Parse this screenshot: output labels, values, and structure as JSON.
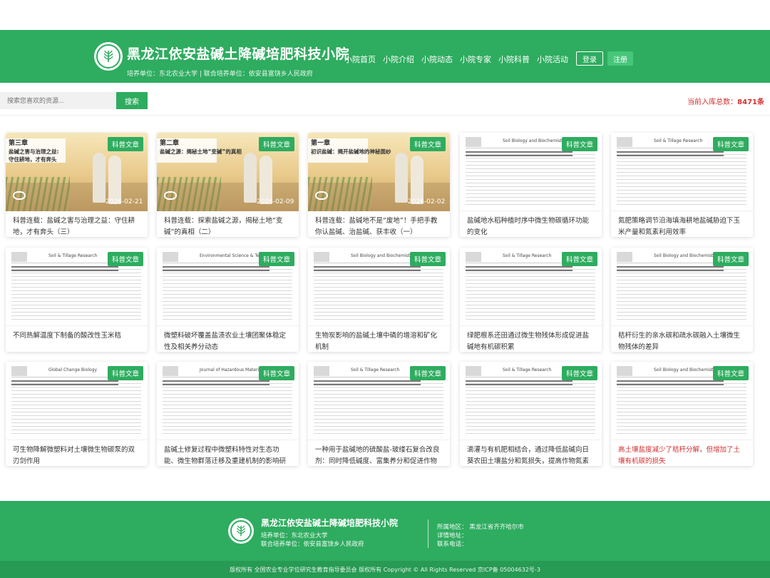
{
  "header": {
    "title": "黑龙江依安盐碱土降碱培肥科技小院",
    "subtitle": "培养单位：东北农业大学 |  联合培养单位：依安县富饶乡人民政府",
    "nav": [
      "小院首页",
      "小院介绍",
      "小院动态",
      "小院专家",
      "小院科普",
      "小院活动"
    ],
    "login": "登录",
    "register": "注册"
  },
  "search": {
    "placeholder": "搜索您喜欢的资源...",
    "button": "搜索",
    "total_label": "当前入库总数：",
    "total_value": "8471条"
  },
  "tag_label": "科普文章",
  "cards": [
    {
      "kind": "photo",
      "title": "科普连载：盐碱之害与治理之益：守住耕地，才有奔头（三）",
      "date": "2026-02-21",
      "ribbon_a": "第三章",
      "ribbon_b": "盐碱之害与治理之益:",
      "ribbon_c": "守住耕地，才有奔头"
    },
    {
      "kind": "photo",
      "title": "科普连载：探索盐碱之源，揭秘土地“变碱”的真相（二）",
      "date": "2026-02-09",
      "ribbon_a": "第二章",
      "ribbon_b": "盐碱之源：揭秘土地“变碱”的真相",
      "ribbon_c": ""
    },
    {
      "kind": "photo",
      "title": "科普连载：盐碱地不是“废地”！手把手教你认盐碱、治盐碱、获丰收（一）",
      "date": "2026-02-02",
      "ribbon_a": "第一章",
      "ribbon_b": "初识盐碱：揭开盐碱地的神秘面纱",
      "ribbon_c": ""
    },
    {
      "kind": "doc",
      "journal": "Soil Biology and Biochemistry",
      "title": "盐碱地水稻种植时序中微生物碳循环功能的变化"
    },
    {
      "kind": "doc",
      "journal": "Soil & Tillage Research",
      "title": "氮肥策略调节沿海填海耕地盐碱胁迫下玉米产量和氮素利用效率"
    },
    {
      "kind": "doc",
      "journal": "Soil & Tillage Research",
      "title": "不同热解温度下制备的酸改性玉米秸"
    },
    {
      "kind": "doc",
      "journal": "Environmental Science & Technology",
      "title": "微塑料破坏覆盖盐渍农业土壤团聚体稳定性及相关养分动态"
    },
    {
      "kind": "doc",
      "journal": "Soil Biology and Biochemistry",
      "title": "生物炭影响的盐碱土壤中磷的增溶和矿化机制"
    },
    {
      "kind": "doc",
      "journal": "Soil & Tillage Research",
      "title": "绿肥根系还田通过微生物残体形成促进盐碱地有机碳积累"
    },
    {
      "kind": "doc",
      "journal": "Soil Biology and Biochemistry",
      "title": "秸秆衍生的亲水碳和疏水碳融入土壤微生物残体的差异"
    },
    {
      "kind": "doc",
      "journal": "Global Change Biology",
      "title": "可生物降解微塑料对土壤微生物碳泵的双刃剑作用"
    },
    {
      "kind": "doc",
      "journal": "Journal of Hazardous Materials",
      "title": "盐碱土修复过程中微塑料特性对生态功能、微生物群落迁移及重建机制的影响研究"
    },
    {
      "kind": "doc",
      "journal": "Soil & Tillage Research",
      "title": "一种用于盐碱地的硫酸盐-玻缕石复合改良剂：同时降低碱度、富集养分和促进作物生长"
    },
    {
      "kind": "doc",
      "journal": "Soil & Tillage Research",
      "title": "滴灌与有机肥相结合，通过降低盐碱向日葵农田土壤盐分和氮损失，提高作物氮素吸收"
    },
    {
      "kind": "doc",
      "journal": "Soil Biology and Biochemistry",
      "title": "高土壤盐度减少了秸秆分解，但增加了土壤有机碳的损失",
      "red": true
    }
  ],
  "footer": {
    "title": "黑龙江依安盐碱土降碱培肥科技小院",
    "unit": "培养单位：东北农业大学",
    "co_unit": "联合培养单位：依安县富饶乡人民政府",
    "region": "所属地区：  黑龙江省齐齐哈尔市",
    "address": "详情地址：",
    "phone": "联系电话：",
    "copyright": "版权所有 全国农业专业学位研究生教育指导委员会 版权所有 Copyright © All Rights Reserved 京ICP备 05004632号-3"
  },
  "colors": {
    "brand": "#2eac5f",
    "accent_red": "#d32f2f"
  }
}
